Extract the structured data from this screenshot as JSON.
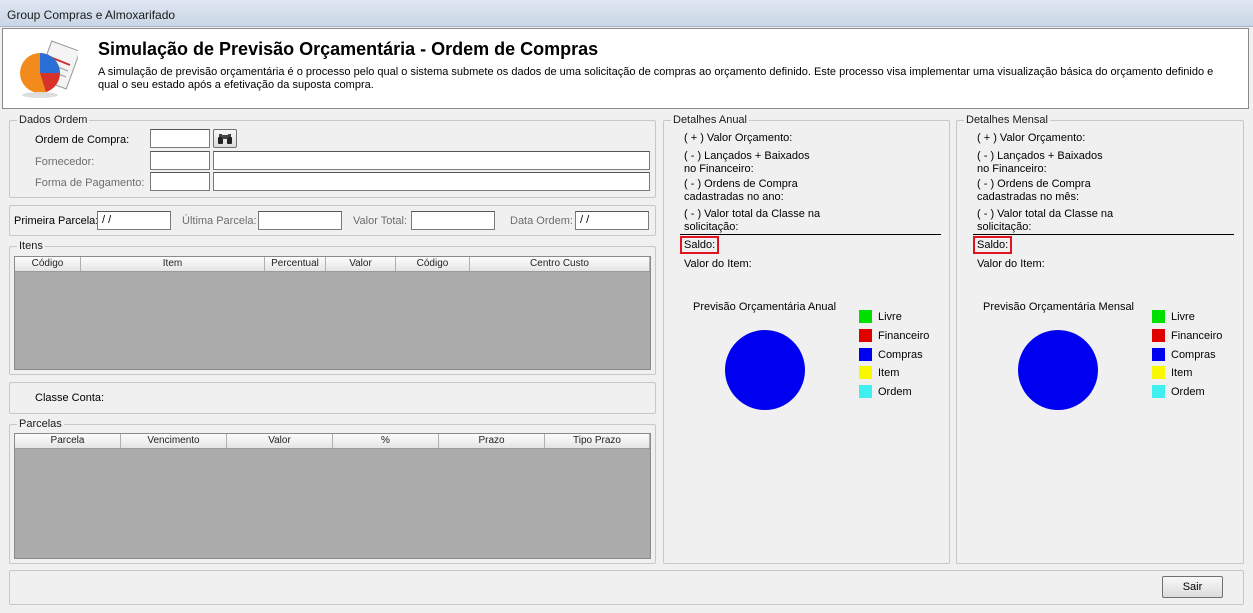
{
  "window": {
    "title": "Group Compras e Almoxarifado"
  },
  "header": {
    "icon": "pie-chart-report-icon",
    "title": "Simulação de Previsão Orçamentária - Ordem de Compras",
    "description": "A simulação de previsão orçamentária é o processo pelo qual o sistema submete os dados de uma solicitação de compras ao orçamento definido. Este processo visa implementar uma visualização básica do orçamento definido e qual o seu estado após a efetivação da suposta compra."
  },
  "dados_ordem": {
    "legend": "Dados Ordem",
    "ordem_label": "Ordem de Compra:",
    "ordem_value": "",
    "search_icon": "binoculars-icon",
    "fornecedor_label": "Fornecedor:",
    "forma_label": "Forma de Pagamento:"
  },
  "parcelas_info": {
    "primeira_label": "Primeira Parcela:",
    "primeira_value": " /  /",
    "ultima_label": "Última Parcela:",
    "valor_total_label": "Valor Total:",
    "data_ordem_label": "Data Ordem:",
    "data_ordem_value": " /  /"
  },
  "itens": {
    "legend": "Itens",
    "columns": [
      "Código",
      "Item",
      "Percentual",
      "Valor",
      "Código",
      "Centro Custo"
    ]
  },
  "classe": {
    "label": "Classe Conta:"
  },
  "parcelas": {
    "legend": "Parcelas",
    "columns": [
      "Parcela",
      "Vencimento",
      "Valor",
      "%",
      "Prazo",
      "Tipo Prazo"
    ]
  },
  "anual": {
    "legend": "Detalhes Anual",
    "valor_orcamento": "( + ) Valor Orçamento:",
    "lancados_1": "( - ) Lançados + Baixados",
    "lancados_2": "no Financeiro:",
    "ordens_1": "( - ) Ordens de Compra",
    "ordens_2": "cadastradas no ano:",
    "classe_1": "( - ) Valor total da Classe na",
    "classe_2": "solicitação:",
    "saldo": "Saldo:",
    "valor_item": "Valor do Item:",
    "chart_title": "Previsão Orçamentária Anual"
  },
  "mensal": {
    "legend": "Detalhes Mensal",
    "valor_orcamento": "( + ) Valor Orçamento:",
    "lancados_1": "( - ) Lançados + Baixados",
    "lancados_2": "no Financeiro:",
    "ordens_1": "( - ) Ordens de Compra",
    "ordens_2": "cadastradas no mês:",
    "classe_1": "( - ) Valor total da Classe na",
    "classe_2": "solicitação:",
    "saldo": "Saldo:",
    "valor_item": "Valor do Item:",
    "chart_title": "Previsão Orçamentária Mensal"
  },
  "legend_items": [
    {
      "label": "Livre",
      "color": "#00e000"
    },
    {
      "label": "Financeiro",
      "color": "#e00000"
    },
    {
      "label": "Compras",
      "color": "#0000f0"
    },
    {
      "label": "Item",
      "color": "#f8f800"
    },
    {
      "label": "Ordem",
      "color": "#40f0f0"
    }
  ],
  "pie_color": "#0000f0",
  "footer": {
    "sair_label": "Sair"
  }
}
